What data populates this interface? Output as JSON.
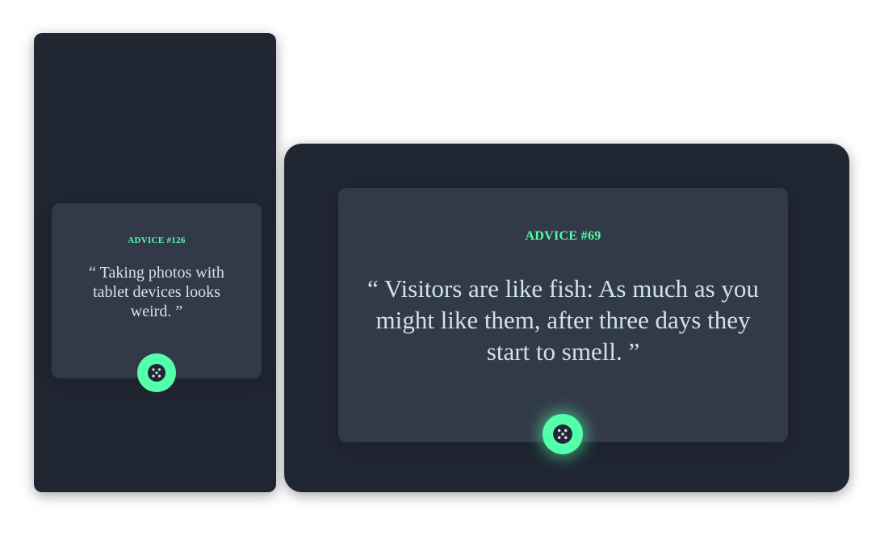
{
  "mobile": {
    "advice_label": "ADVICE #126",
    "quote": "“ Taking photos with tablet devices looks weird. ”",
    "button_icon": "dice-icon"
  },
  "desktop": {
    "advice_label": "ADVICE #69",
    "quote": "“ Visitors are like fish: As much as you might like them, after three days they start to smell. ”",
    "button_icon": "dice-icon"
  },
  "colors": {
    "page_background": "#ffffff",
    "frame_background": "#202632",
    "card_background": "#323a49",
    "accent": "#53ffaa",
    "text": "#cee3e9"
  }
}
